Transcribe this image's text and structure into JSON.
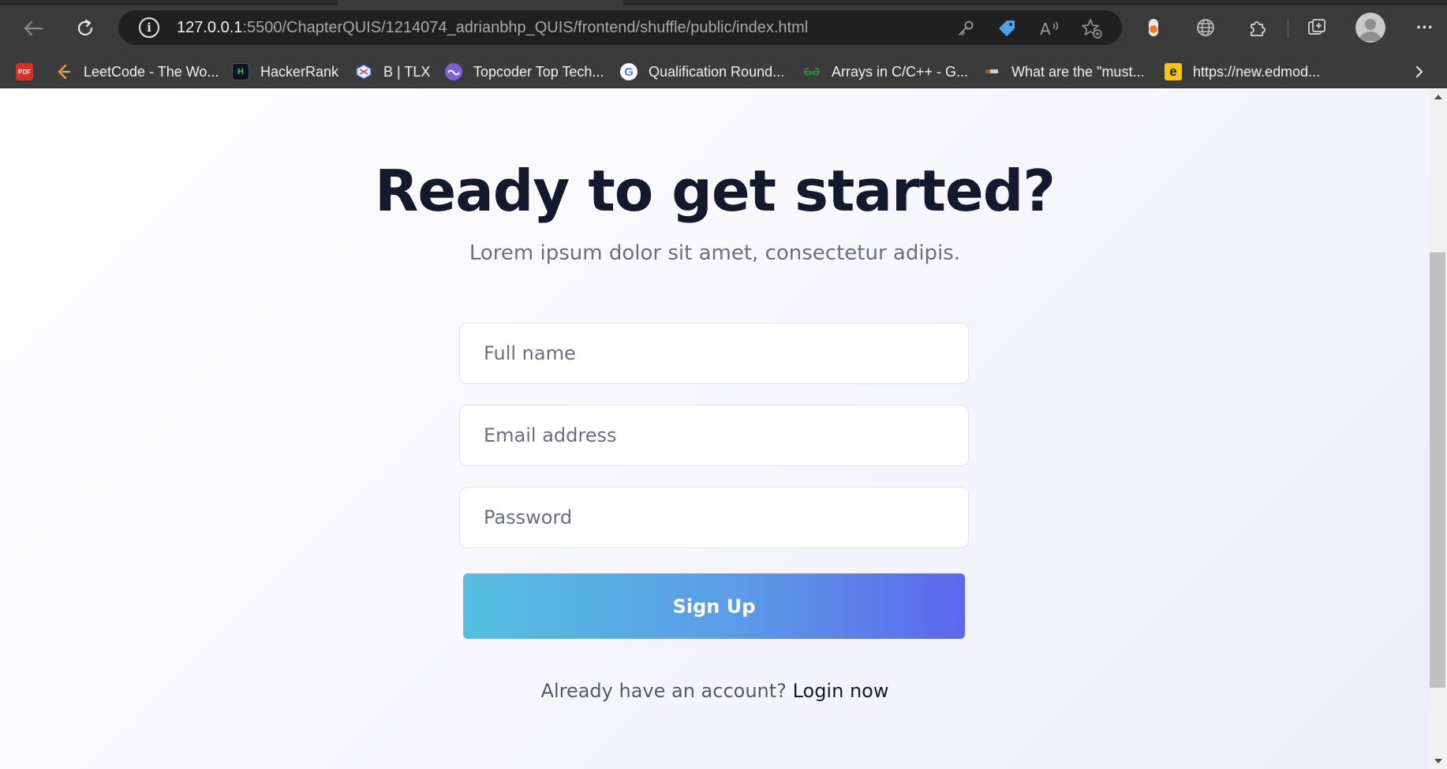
{
  "browser": {
    "url_host": "127.0.0.1",
    "url_rest": ":5500/ChapterQUIS/1214074_adrianbhp_QUIS/frontend/shuffle/public/index.html",
    "more_label": "···"
  },
  "bookmarks": [
    {
      "icon": "pdf-icon",
      "badge": "PDF",
      "label": ""
    },
    {
      "icon": "leetcode-icon",
      "badge": "",
      "label": "LeetCode - The Wo..."
    },
    {
      "icon": "hackerrank-icon",
      "badge": "H",
      "label": "HackerRank"
    },
    {
      "icon": "tlx-icon",
      "badge": "",
      "label": "B | TLX"
    },
    {
      "icon": "topcoder-icon",
      "badge": "",
      "label": "Topcoder Top Tech..."
    },
    {
      "icon": "google-icon",
      "badge": "G",
      "label": "Qualification Round..."
    },
    {
      "icon": "geeksforgeeks-icon",
      "badge": "",
      "label": "Arrays in C/C++ - G..."
    },
    {
      "icon": "site-icon",
      "badge": "",
      "label": "What are the \"must..."
    },
    {
      "icon": "edmodo-icon",
      "badge": "e",
      "label": "https://new.edmod..."
    }
  ],
  "page": {
    "headline": "Ready to get started?",
    "subheading": "Lorem ipsum dolor sit amet, consectetur adipis.",
    "form": {
      "full_name_placeholder": "Full name",
      "email_placeholder": "Email address",
      "password_placeholder": "Password",
      "submit_label": "Sign Up"
    },
    "login_prompt": "Already have an account?",
    "login_link": "Login now"
  },
  "colors": {
    "headline": "#141a2c",
    "button_start": "#54bfe0",
    "button_end": "#5c67ee",
    "chrome": "#3b3b3b"
  }
}
